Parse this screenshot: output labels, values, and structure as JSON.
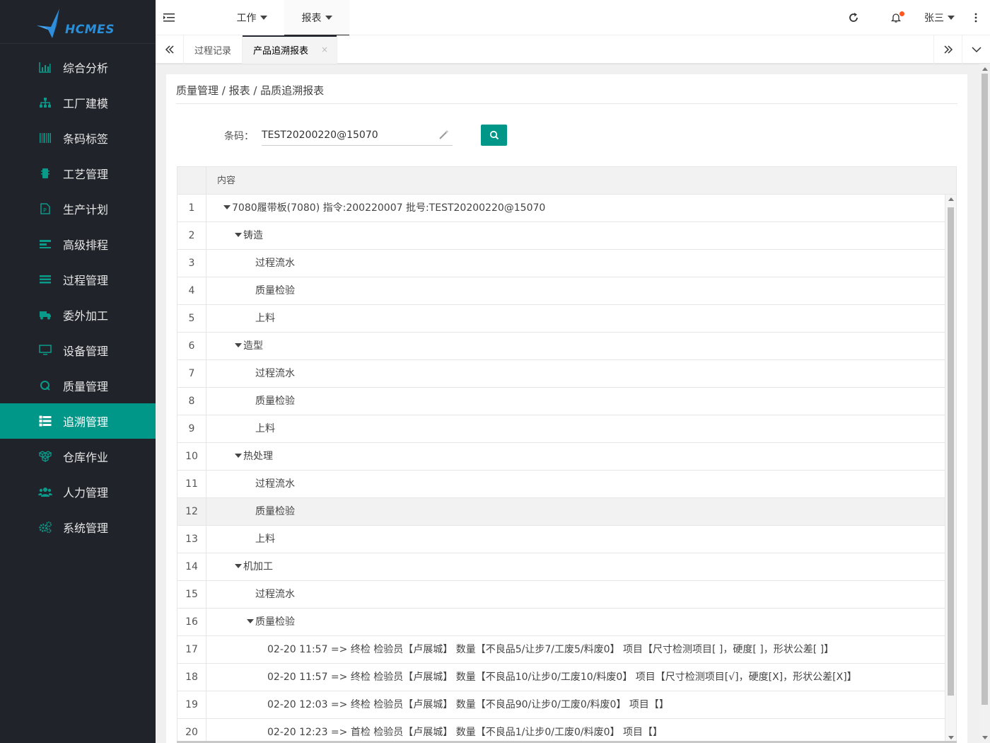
{
  "app": {
    "logo_text": "HCMES",
    "accent": "#009688",
    "sidebar_bg": "#20232a"
  },
  "sidebar": {
    "items": [
      {
        "label": "综合分析",
        "icon": "bar-chart-icon"
      },
      {
        "label": "工厂建模",
        "icon": "org-chart-icon"
      },
      {
        "label": "条码标签",
        "icon": "barcode-icon"
      },
      {
        "label": "工艺管理",
        "icon": "chip-icon"
      },
      {
        "label": "生产计划",
        "icon": "document-icon"
      },
      {
        "label": "高级排程",
        "icon": "schedule-icon"
      },
      {
        "label": "过程管理",
        "icon": "list-icon"
      },
      {
        "label": "委外加工",
        "icon": "truck-icon"
      },
      {
        "label": "设备管理",
        "icon": "monitor-icon"
      },
      {
        "label": "质量管理",
        "icon": "quality-icon"
      },
      {
        "label": "追溯管理",
        "icon": "trace-list-icon",
        "active": true
      },
      {
        "label": "仓库作业",
        "icon": "boxes-icon"
      },
      {
        "label": "人力管理",
        "icon": "users-icon"
      },
      {
        "label": "系统管理",
        "icon": "gears-icon"
      }
    ]
  },
  "header": {
    "nav": [
      {
        "label": "工作"
      },
      {
        "label": "报表",
        "active": true
      }
    ],
    "user_name": "张三"
  },
  "tabs": [
    {
      "label": "过程记录"
    },
    {
      "label": "产品追溯报表",
      "active": true,
      "close": "×"
    }
  ],
  "page": {
    "breadcrumb": "质量管理 / 报表 / 品质追溯报表",
    "search": {
      "label": "条码：",
      "value": "TEST20200220@15070"
    }
  },
  "table": {
    "header": "内容",
    "rows": [
      {
        "num": "1",
        "text": "7080履带板(7080) 指令:200220007 批号:TEST20200220@15070",
        "level": "lvl0",
        "expanded": true
      },
      {
        "num": "2",
        "text": "铸造",
        "level": "lvl1",
        "expanded": true
      },
      {
        "num": "3",
        "text": "过程流水",
        "level": "lvl2"
      },
      {
        "num": "4",
        "text": "质量检验",
        "level": "lvl2"
      },
      {
        "num": "5",
        "text": "上料",
        "level": "lvl2"
      },
      {
        "num": "6",
        "text": "造型",
        "level": "lvl1",
        "expanded": true
      },
      {
        "num": "7",
        "text": "过程流水",
        "level": "lvl2"
      },
      {
        "num": "8",
        "text": "质量检验",
        "level": "lvl2"
      },
      {
        "num": "9",
        "text": "上料",
        "level": "lvl2"
      },
      {
        "num": "10",
        "text": "热处理",
        "level": "lvl1",
        "expanded": true
      },
      {
        "num": "11",
        "text": "过程流水",
        "level": "lvl2"
      },
      {
        "num": "12",
        "text": "质量检验",
        "level": "lvl2",
        "hover": true
      },
      {
        "num": "13",
        "text": "上料",
        "level": "lvl2"
      },
      {
        "num": "14",
        "text": "机加工",
        "level": "lvl1",
        "expanded": true
      },
      {
        "num": "15",
        "text": "过程流水",
        "level": "lvl2"
      },
      {
        "num": "16",
        "text": "质量检验",
        "level": "lvl2t",
        "expanded": true
      },
      {
        "num": "17",
        "text": "02-20 11:57 => 终检 检验员【卢展城】 数量【不良品5/让步7/工废5/料废0】 项目【尺寸检测项目[ ]，硬度[ ]，形状公差[ ]】",
        "level": "lvl3"
      },
      {
        "num": "18",
        "text": "02-20 11:57 => 终检 检验员【卢展城】 数量【不良品10/让步0/工废10/料废0】 项目【尺寸检测项目[√]，硬度[X]，形状公差[X]】",
        "level": "lvl3"
      },
      {
        "num": "19",
        "text": "02-20 12:03 => 终检 检验员【卢展城】 数量【不良品90/让步0/工废0/料废0】 项目【】",
        "level": "lvl3"
      },
      {
        "num": "20",
        "text": "02-20 12:23 => 首检 检验员【卢展城】 数量【不良品1/让步0/工废0/料废0】 项目【】",
        "level": "lvl3"
      }
    ]
  }
}
